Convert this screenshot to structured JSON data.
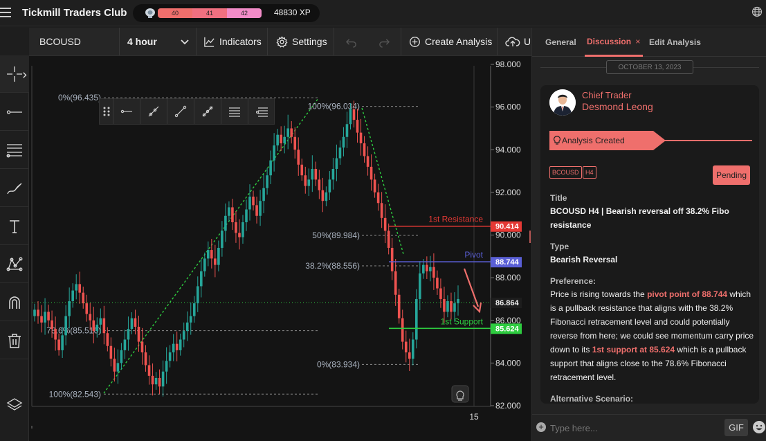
{
  "app": {
    "title": "Tickmill Traders Club"
  },
  "xp": {
    "segments": [
      "40",
      "41",
      "42"
    ],
    "segment_colors": [
      "#ef6f6c",
      "#f07080",
      "#f28cc8"
    ],
    "total": "48830 XP"
  },
  "toolbar": {
    "symbol": "BCOUSD",
    "interval": "4 hour",
    "indicators": "Indicators",
    "settings": "Settings",
    "create_analysis": "Create Analysis",
    "upload_partial": "U"
  },
  "chart_data": {
    "type": "candlestick",
    "symbol": "BCOUSD",
    "interval": "4 hour",
    "ylim": [
      82.0,
      98.0
    ],
    "yticks": [
      "98.000",
      "96.000",
      "94.000",
      "92.000",
      "90.000",
      "88.000",
      "86.000",
      "84.000",
      "82.000"
    ],
    "xticks": [
      "15"
    ],
    "current_price": "86.864",
    "fib_left": [
      {
        "label": "0%(96.435)",
        "price": 96.435
      },
      {
        "label": "78.6%(85.516)",
        "price": 85.516
      },
      {
        "label": "100%(82.543)",
        "price": 82.543
      }
    ],
    "fib_right": [
      {
        "label": "100%(96.034)",
        "price": 96.034
      },
      {
        "label": "50%(89.984)",
        "price": 89.984
      },
      {
        "label": "38.2%(88.556)",
        "price": 88.556
      },
      {
        "label": "0%(83.934)",
        "price": 83.934
      }
    ],
    "levels": [
      {
        "name": "1st Resistance",
        "price": 90.414,
        "label": "90.414",
        "color": "#e53935"
      },
      {
        "name": "Pivot",
        "price": 88.744,
        "label": "88.744",
        "color": "#5a5fd6"
      },
      {
        "name": "1st Support",
        "price": 85.624,
        "label": "85.624",
        "color": "#2ecc40"
      }
    ],
    "closes": [
      86.5,
      86.2,
      85.9,
      86.4,
      86.0,
      85.6,
      85.1,
      84.6,
      85.3,
      86.2,
      86.9,
      87.4,
      87.7,
      87.3,
      86.8,
      86.3,
      86.0,
      85.5,
      85.8,
      86.1,
      85.4,
      84.8,
      84.2,
      83.6,
      84.0,
      84.6,
      85.1,
      85.6,
      86.1,
      85.7,
      85.0,
      84.5,
      83.9,
      83.4,
      83.0,
      83.3,
      82.9,
      83.6,
      84.1,
      84.5,
      84.9,
      84.6,
      85.1,
      85.5,
      85.9,
      86.2,
      86.8,
      87.6,
      88.3,
      88.9,
      89.3,
      88.9,
      88.6,
      89.4,
      90.2,
      90.9,
      91.3,
      90.6,
      90.1,
      89.9,
      90.6,
      91.2,
      91.8,
      91.4,
      90.9,
      91.6,
      92.2,
      92.8,
      93.5,
      94.2,
      94.7,
      94.3,
      94.6,
      95.0,
      94.6,
      94.0,
      93.3,
      92.8,
      92.3,
      92.6,
      93.1,
      92.6,
      92.1,
      91.6,
      92.0,
      92.6,
      93.1,
      93.6,
      94.1,
      94.6,
      95.2,
      95.9,
      95.4,
      94.8,
      94.3,
      93.7,
      93.2,
      92.6,
      92.0,
      91.5,
      90.8,
      90.2,
      89.4,
      88.3,
      87.2,
      86.1,
      85.0,
      84.5,
      84.2,
      85.1,
      87.0,
      88.2,
      88.6,
      88.3,
      88.5,
      88.0,
      87.5,
      87.0,
      86.4,
      86.9,
      86.4,
      86.8,
      87.0
    ]
  },
  "tools": [
    "crosshair-icon",
    "line-icon",
    "fib-icon",
    "brush-icon",
    "text-icon",
    "pattern-icon",
    "magnet-icon",
    "trash-icon",
    "layers-icon"
  ],
  "tabs": {
    "general": "General",
    "discussion": "Discussion",
    "discussion_close": "×",
    "edit": "Edit Analysis"
  },
  "discussion": {
    "date": "OCTOBER 13, 2023",
    "author_role": "Chief Trader",
    "author_name": "Desmond Leong",
    "status_tag": "Analysis Created",
    "tags": [
      "BCOUSD",
      "H4"
    ],
    "state": "Pending",
    "title_label": "Title",
    "title_value": "BCOUSD H4 | Bearish reversal off 38.2% Fibo resistance",
    "type_label": "Type",
    "type_value": "Bearish Reversal",
    "pref_label": "Preference:",
    "pref_1": "Price is rising towards the ",
    "pref_hl1": "pivot point of 88.744",
    "pref_2": " which is a pullback resistance that aligns with the 38.2% Fibonacci retracement level and could potentially reverse from here; we could see momentum carry price down to its ",
    "pref_hl2": "1st support at 85.624",
    "pref_3": " which is a pullback support that aligns close to the 78.6% Fibonacci retracement level.",
    "alt_label": "Alternative Scenario:"
  },
  "input": {
    "placeholder": "Type here...",
    "gif": "GIF"
  }
}
